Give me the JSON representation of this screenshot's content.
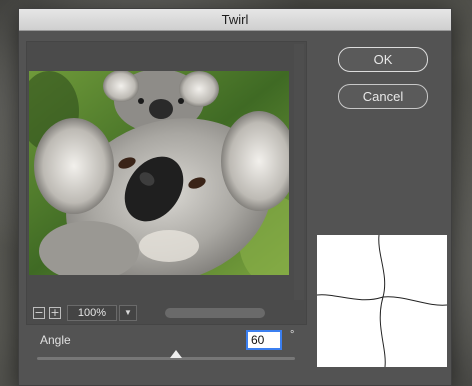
{
  "dialog": {
    "title": "Twirl"
  },
  "buttons": {
    "ok_label": "OK",
    "cancel_label": "Cancel"
  },
  "preview": {
    "zoom_out_icon": "minus-square-icon",
    "zoom_in_icon": "plus-square-icon",
    "zoom_out_glyph": "−",
    "zoom_in_glyph": "+",
    "zoom_value": "100%",
    "zoom_dropdown_glyph": "▼"
  },
  "angle": {
    "label": "Angle",
    "value": "60",
    "unit": "°",
    "fraction": 0.54
  },
  "colors": {
    "dialog_bg": "#535353",
    "focus_ring": "#3b7ff0",
    "titlebar": "#d9d9d9"
  }
}
